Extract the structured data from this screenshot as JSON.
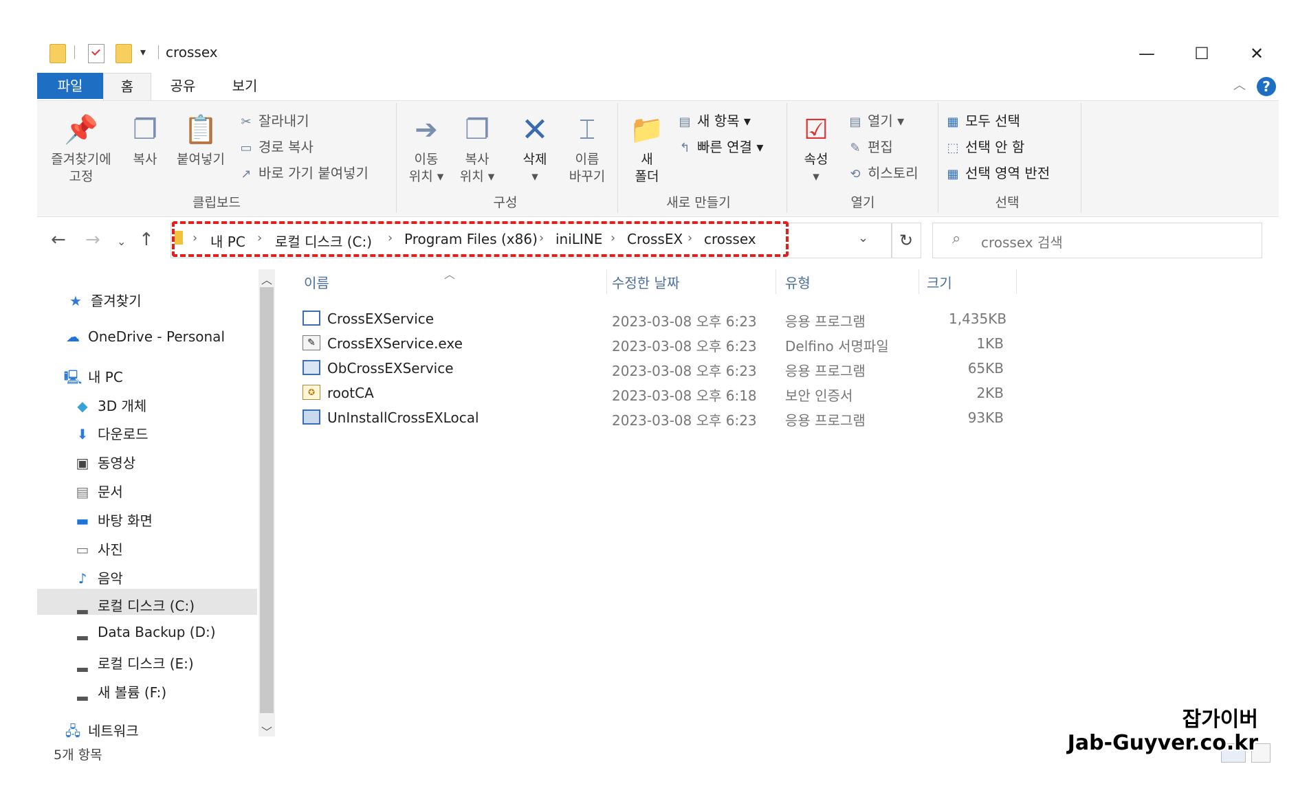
{
  "window": {
    "title": "crossex",
    "controls": {
      "minimize": "—",
      "maximize": "☐",
      "close": "✕"
    }
  },
  "ribbon_tabs": [
    "파일",
    "홈",
    "공유",
    "보기"
  ],
  "ribbon": {
    "clipboard": {
      "pin_label_1": "즐겨찾기에",
      "pin_label_2": "고정",
      "copy": "복사",
      "paste": "붙여넣기",
      "cut": "잘라내기",
      "copy_path": "경로 복사",
      "paste_shortcut": "바로 가기 붙여넣기",
      "group": "클립보드"
    },
    "organize": {
      "move_to_1": "이동",
      "move_to_2": "위치",
      "copy_to_1": "복사",
      "copy_to_2": "위치",
      "delete": "삭제",
      "rename_1": "이름",
      "rename_2": "바꾸기",
      "group": "구성"
    },
    "new": {
      "new_folder_1": "새",
      "new_folder_2": "폴더",
      "new_item": "새 항목",
      "easy_access": "빠른 연결",
      "group": "새로 만들기"
    },
    "open": {
      "properties": "속성",
      "open": "열기",
      "edit": "편집",
      "history": "히스토리",
      "group": "열기"
    },
    "select": {
      "select_all": "모두 선택",
      "select_none": "선택 안 함",
      "invert": "선택 영역 반전",
      "group": "선택"
    }
  },
  "address": {
    "crumbs": [
      "내 PC",
      "로컬 디스크 (C:)",
      "Program Files (x86)",
      "iniLINE",
      "CrossEX",
      "crossex"
    ],
    "search_placeholder": "crossex 검색"
  },
  "sidebar": {
    "items": [
      {
        "label": "즐겨찾기",
        "icon": "star-icon"
      },
      {
        "label": "OneDrive - Personal",
        "icon": "cloud-icon"
      },
      {
        "label": "내 PC",
        "icon": "computer-icon"
      },
      {
        "label": "3D 개체",
        "icon": "cube-icon"
      },
      {
        "label": "다운로드",
        "icon": "download-icon"
      },
      {
        "label": "동영상",
        "icon": "video-icon"
      },
      {
        "label": "문서",
        "icon": "document-icon"
      },
      {
        "label": "바탕 화면",
        "icon": "desktop-icon"
      },
      {
        "label": "사진",
        "icon": "picture-icon"
      },
      {
        "label": "음악",
        "icon": "music-icon"
      },
      {
        "label": "로컬 디스크 (C:)",
        "icon": "drive-icon"
      },
      {
        "label": "Data Backup (D:)",
        "icon": "drive-icon"
      },
      {
        "label": "로컬 디스크 (E:)",
        "icon": "drive-icon"
      },
      {
        "label": "새 볼륨 (F:)",
        "icon": "drive-icon"
      },
      {
        "label": "네트워크",
        "icon": "network-icon"
      }
    ],
    "selected": "로컬 디스크 (C:)"
  },
  "file_list": {
    "columns": [
      "이름",
      "수정한 날짜",
      "유형",
      "크기"
    ],
    "rows": [
      {
        "name": "CrossEXService",
        "date": "2023-03-08 오후 6:23",
        "type": "응용 프로그램",
        "size": "1,435KB",
        "icon": "application-icon"
      },
      {
        "name": "CrossEXService.exe",
        "date": "2023-03-08 오후 6:23",
        "type": "Delfino 서명파일",
        "size": "1KB",
        "icon": "signature-file-icon"
      },
      {
        "name": "ObCrossEXService",
        "date": "2023-03-08 오후 6:23",
        "type": "응용 프로그램",
        "size": "65KB",
        "icon": "application-icon"
      },
      {
        "name": "rootCA",
        "date": "2023-03-08 오후 6:18",
        "type": "보안 인증서",
        "size": "2KB",
        "icon": "certificate-icon"
      },
      {
        "name": "UnInstallCrossEXLocal",
        "date": "2023-03-08 오후 6:23",
        "type": "응용 프로그램",
        "size": "93KB",
        "icon": "uninstaller-icon"
      }
    ]
  },
  "status_bar": {
    "count": "5개 항목"
  },
  "watermark": {
    "line1": "잡가이버",
    "line2": "Jab-Guyver.co.kr"
  }
}
